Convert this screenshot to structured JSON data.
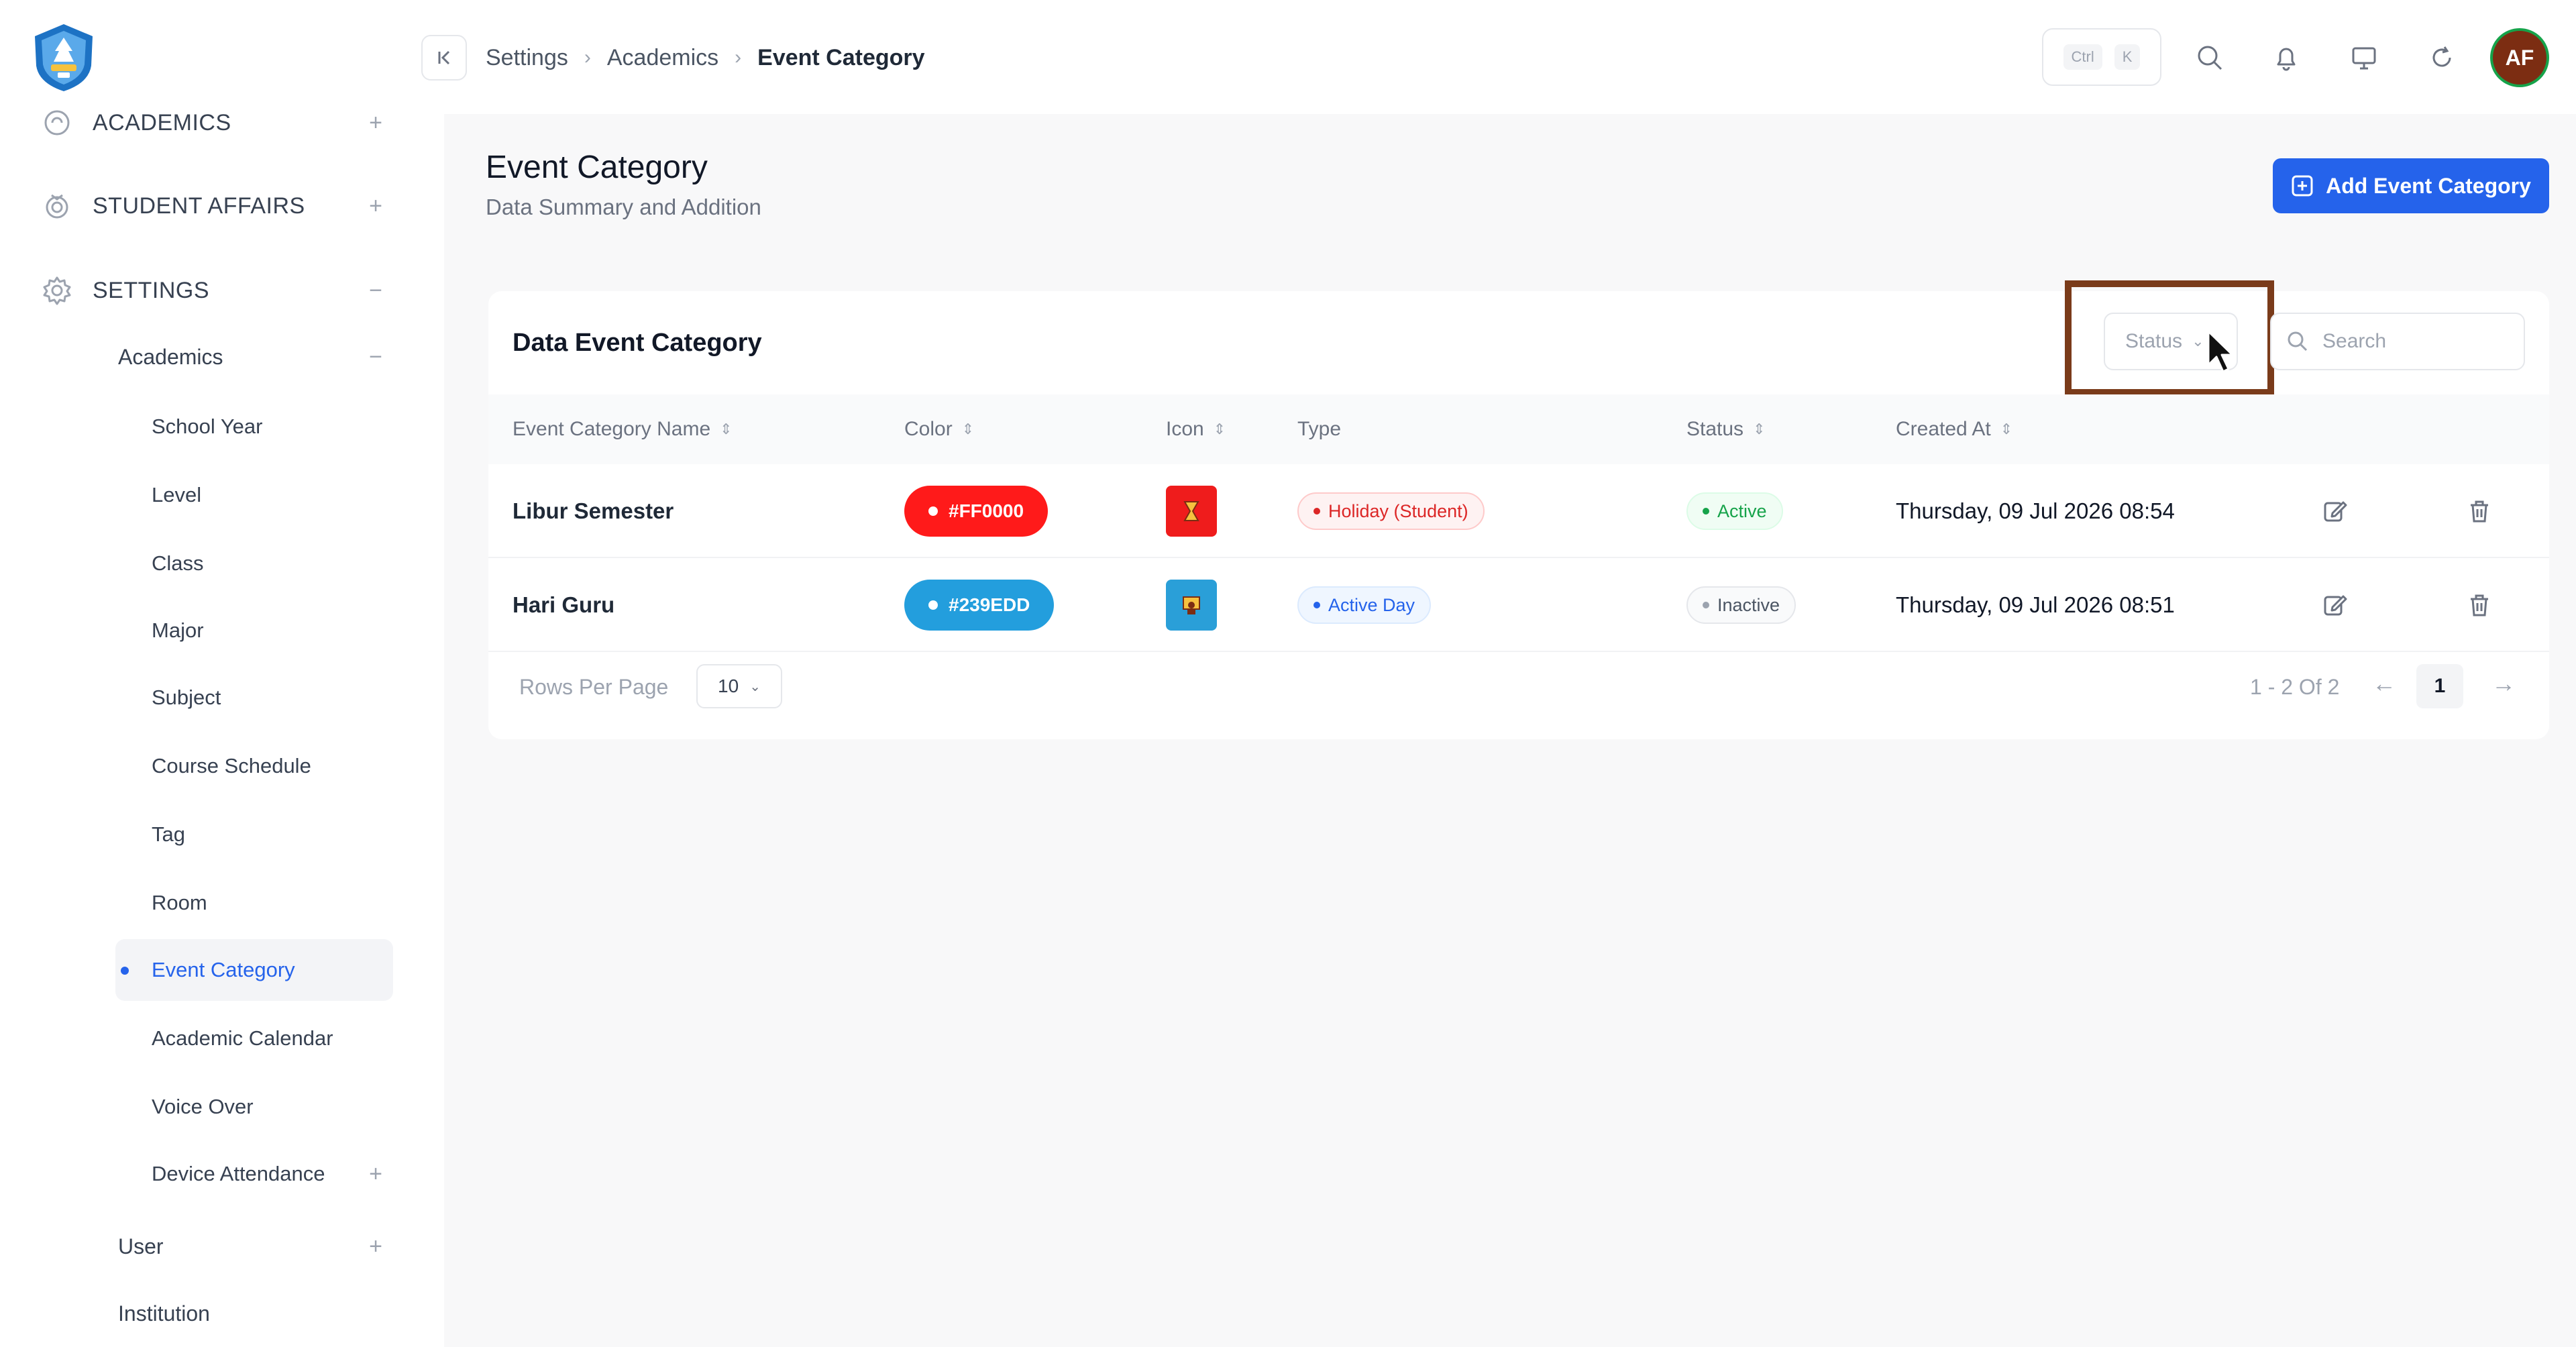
{
  "sidebar": {
    "sections": [
      {
        "label": "ACADEMICS",
        "toggle": "+",
        "icon": "academics-icon"
      },
      {
        "label": "STUDENT AFFAIRS",
        "toggle": "+",
        "icon": "badge-icon"
      },
      {
        "label": "SETTINGS",
        "toggle": "−",
        "icon": "gear-icon"
      }
    ],
    "academics_group": {
      "label": "Academics",
      "toggle": "−"
    },
    "items": [
      {
        "label": "School Year"
      },
      {
        "label": "Level"
      },
      {
        "label": "Class"
      },
      {
        "label": "Major"
      },
      {
        "label": "Subject"
      },
      {
        "label": "Course Schedule"
      },
      {
        "label": "Tag"
      },
      {
        "label": "Room"
      },
      {
        "label": "Event Category"
      },
      {
        "label": "Academic Calendar"
      },
      {
        "label": "Voice Over"
      },
      {
        "label": "Device Attendance",
        "toggle": "+"
      }
    ],
    "user_group": {
      "label": "User",
      "toggle": "+"
    },
    "institution_group": {
      "label": "Institution"
    }
  },
  "header": {
    "breadcrumb": [
      "Settings",
      "Academics",
      "Event Category"
    ],
    "shortcut": {
      "ctrl": "Ctrl",
      "key": "K"
    },
    "avatar_initials": "AF"
  },
  "page": {
    "title": "Event Category",
    "subtitle": "Data Summary and Addition",
    "add_button_label": "Add Event Category"
  },
  "card": {
    "title": "Data Event Category",
    "status_placeholder": "Status",
    "search_placeholder": "Search",
    "columns": [
      "Event Category Name",
      "Color",
      "Icon",
      "Type",
      "Status",
      "Created At"
    ],
    "rows": [
      {
        "name": "Libur Semester",
        "color_label": "#FF0000",
        "color_hex": "#ff1a1a",
        "icon_bg": "#ef1c1c",
        "type": "Holiday (Student)",
        "status": "Active",
        "created_at": "Thursday, 09 Jul 2026 08:54"
      },
      {
        "name": "Hari Guru",
        "color_label": "#239EDD",
        "color_hex": "#239edd",
        "icon_bg": "#2a9fd8",
        "type": "Active Day",
        "status": "Inactive",
        "created_at": "Thursday, 09 Jul 2026 08:51"
      }
    ],
    "footer": {
      "rows_per_page_label": "Rows Per Page",
      "rows_per_page_value": "10",
      "range": "1 - 2 Of 2",
      "current_page": "1"
    }
  },
  "colors": {
    "accent": "#2563eb",
    "highlight_border": "#7a3b1a",
    "background": "#f8f8f9"
  }
}
